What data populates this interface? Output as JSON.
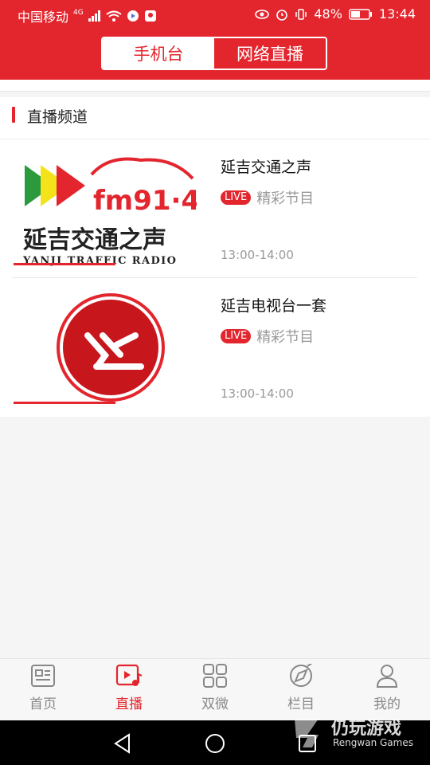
{
  "status_bar": {
    "carrier": "中国移动",
    "network": "4G",
    "battery": "48%",
    "time": "13:44"
  },
  "header": {
    "tabs": [
      {
        "label": "手机台",
        "active": true
      },
      {
        "label": "网络直播",
        "active": false
      }
    ]
  },
  "section": {
    "title": "直播频道"
  },
  "channels": [
    {
      "name": "延吉交通之声",
      "live_badge": "LIVE",
      "program": "精彩节目",
      "time": "13:00-14:00",
      "logo": {
        "freq": "fm91·4",
        "name_cn": "延吉交通之声",
        "name_en": "YANJI TRAFFIC RADIO"
      }
    },
    {
      "name": "延吉电视台一套",
      "live_badge": "LIVE",
      "program": "精彩节目",
      "time": "13:00-14:00",
      "logo": {}
    }
  ],
  "tabbar": {
    "items": [
      {
        "label": "首页",
        "icon": "news-icon",
        "active": false
      },
      {
        "label": "直播",
        "icon": "live-video-icon",
        "active": true
      },
      {
        "label": "双微",
        "icon": "grid-icon",
        "active": false
      },
      {
        "label": "栏目",
        "icon": "compass-icon",
        "active": false
      },
      {
        "label": "我的",
        "icon": "user-icon",
        "active": false
      }
    ]
  },
  "watermark": {
    "cn": "仍玩游戏",
    "en": "Rengwan Games"
  },
  "colors": {
    "brand": "#e3262e",
    "muted": "#999999",
    "tab_inactive": "#888888"
  }
}
